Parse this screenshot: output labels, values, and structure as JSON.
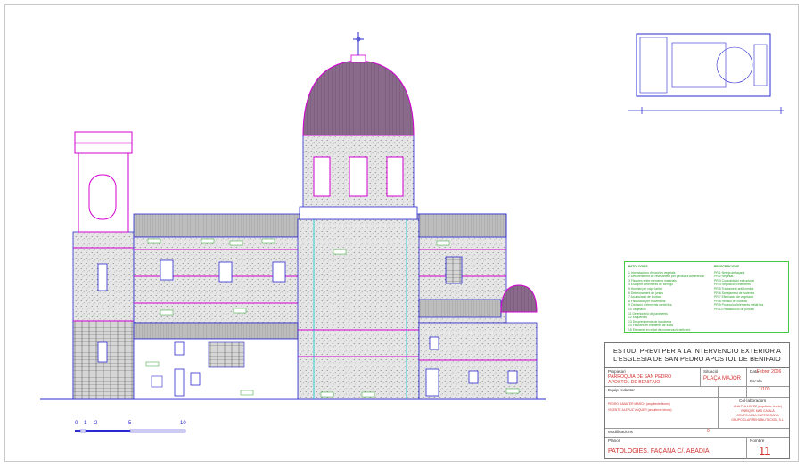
{
  "legend": {
    "patologies_heading": "PATOLOGIES",
    "patologies": [
      "1    Incrustacions d'escòries vegetals",
      "2    Despreniment de revestiment per pèrdua d'adherència",
      "3    Fissures entre elements materials",
      "4    Escupint d'elements de formigó",
      "5    Humitat per capil·laritat",
      "6    Deteriorament de juntes",
      "7    Acumulació de brutícia",
      "8    Fissuració per moviments",
      "9    Oxidació d'elements metàl·lics",
      "10   Vegetació",
      "11   Deterioració de paviments",
      "12   Esquerdes",
      "13   Despreniments de la coberta",
      "14   Fissures en elements de fusta",
      "15   Elements en estat de conservació deficient"
    ],
    "prescripcions_heading": "PRESCRIPCIONS",
    "prescripcions": [
      "PR-1  Neteja de façana",
      "PR-2  Rejuntat",
      "PR-3  Consolidació estructural",
      "PR-4  Reposició d'elements",
      "PR-5  Tractament anti-humitat",
      "PR-6  Sanejament de fusteries",
      "PR-7  Eliminació de vegetació",
      "PR-8  Revisió de coberta",
      "PR-9  Protecció d'elements metàl·lics",
      "PR-10 Restauració de pintura"
    ]
  },
  "title_block": {
    "title_line1": "ESTUDI PREVI PER A LA INTERVENCIO EXTERIOR A",
    "title_line2": "L'ESGLESIA DE SAN PEDRO APOSTOL DE BENIFAIO",
    "propietari_label": "Propietari",
    "propietari_line1": "PARROQUIA DE SAN PEDRO",
    "propietari_line2": "APOSTOL DE BENIFAIO",
    "data_label": "Data",
    "data_value": "Febrer 2006",
    "situacio_label": "Situació",
    "situacio_value": "PLAÇA MAJOR",
    "escala_label": "Escala",
    "escala_value": "1/100",
    "equip_label": "Equip redactor",
    "equip_line1": "PEDRO SABATER MARCH (arquitecte tècnic)",
    "equip_line2": "VICENTE ALEPUZ VAQUER (arquitecte tècnic)",
    "collaboradors_label": "Col·laboradors",
    "collaboradors": [
      "ANA PLA LOPEZ (arquitecte tècnic)",
      "ENRIQUE MAS CATALÀ",
      "GRUPO ACSA CARTOGRAFIA",
      "GRUPO CLAR REHABILITACION, S.L."
    ],
    "modificacions_label": "Modificacions",
    "modificacions_value": "0",
    "pla_label": "Plànol",
    "pla_value": "PATOLOGIES. FAÇANA C/. ABADIA",
    "nombre_label": "Nombre",
    "nombre_value": "11"
  },
  "scale_bar": {
    "labels": [
      "0",
      "1",
      "2",
      "5",
      "10"
    ]
  },
  "colors": {
    "outline": "#2a2ad0",
    "magenta": "#d200d2",
    "cyan": "#00c8d2",
    "green": "#2aa02a",
    "red": "#d23232"
  }
}
